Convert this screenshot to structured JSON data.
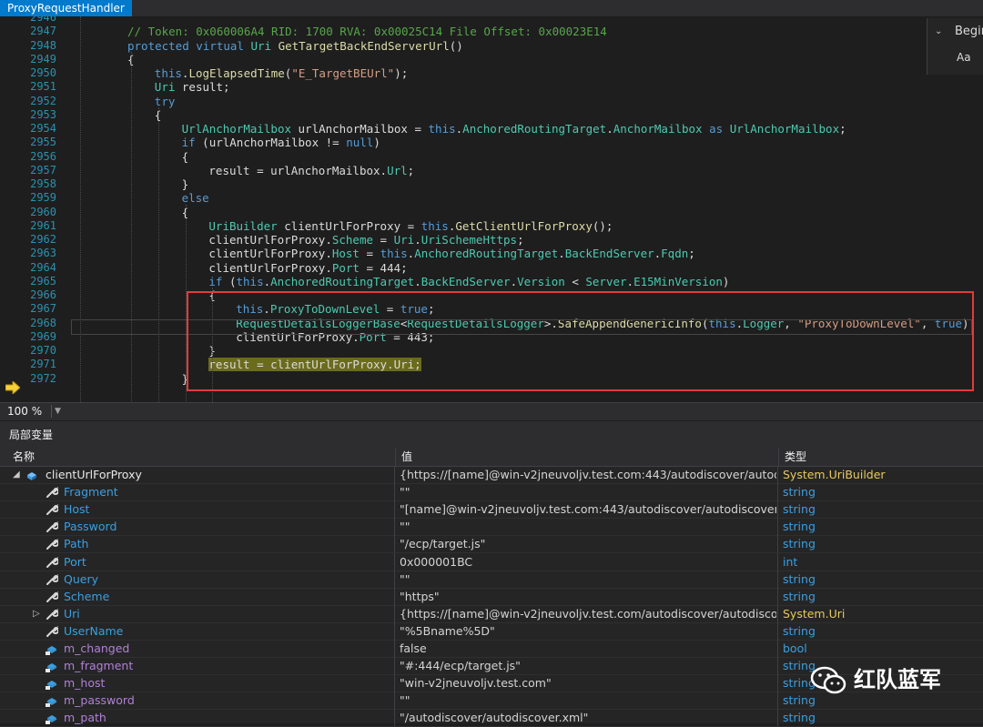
{
  "tab": {
    "title": "ProxyRequestHandler"
  },
  "find": {
    "search_value": "Begin",
    "match_case_label": "Aa"
  },
  "editor": {
    "zoom": "100 %",
    "lines": [
      {
        "n": "2946",
        "indent": 0,
        "tokens": []
      },
      {
        "n": "2947",
        "indent": 1,
        "tokens": [
          {
            "c": "cm",
            "t": "// Token: 0x060006A4 RID: 1700 RVA: 0x00025C14 File Offset: 0x00023E14"
          }
        ]
      },
      {
        "n": "2948",
        "indent": 1,
        "tokens": [
          {
            "c": "kw",
            "t": "protected virtual "
          },
          {
            "c": "ty",
            "t": "Uri "
          },
          {
            "c": "fn",
            "t": "GetTargetBackEndServerUrl"
          },
          {
            "c": "",
            "t": "()"
          }
        ]
      },
      {
        "n": "2949",
        "indent": 1,
        "tokens": [
          {
            "c": "",
            "t": "{"
          }
        ]
      },
      {
        "n": "2950",
        "indent": 2,
        "tokens": [
          {
            "c": "kw",
            "t": "this"
          },
          {
            "c": "",
            "t": "."
          },
          {
            "c": "fn",
            "t": "LogElapsedTime"
          },
          {
            "c": "",
            "t": "("
          },
          {
            "c": "st",
            "t": "\"E_TargetBEUrl\""
          },
          {
            "c": "",
            "t": ");"
          }
        ]
      },
      {
        "n": "2951",
        "indent": 2,
        "tokens": [
          {
            "c": "ty",
            "t": "Uri "
          },
          {
            "c": "",
            "t": "result;"
          }
        ]
      },
      {
        "n": "2952",
        "indent": 2,
        "tokens": [
          {
            "c": "kw",
            "t": "try"
          }
        ]
      },
      {
        "n": "2953",
        "indent": 2,
        "tokens": [
          {
            "c": "",
            "t": "{"
          }
        ]
      },
      {
        "n": "2954",
        "indent": 3,
        "tokens": [
          {
            "c": "ty",
            "t": "UrlAnchorMailbox "
          },
          {
            "c": "",
            "t": "urlAnchorMailbox = "
          },
          {
            "c": "kw",
            "t": "this"
          },
          {
            "c": "",
            "t": "."
          },
          {
            "c": "ty",
            "t": "AnchoredRoutingTarget"
          },
          {
            "c": "",
            "t": "."
          },
          {
            "c": "ty",
            "t": "AnchorMailbox "
          },
          {
            "c": "kw",
            "t": "as "
          },
          {
            "c": "ty",
            "t": "UrlAnchorMailbox"
          },
          {
            "c": "",
            "t": ";"
          }
        ]
      },
      {
        "n": "2955",
        "indent": 3,
        "tokens": [
          {
            "c": "kw",
            "t": "if "
          },
          {
            "c": "",
            "t": "(urlAnchorMailbox != "
          },
          {
            "c": "kw",
            "t": "null"
          },
          {
            "c": "",
            "t": ")"
          }
        ]
      },
      {
        "n": "2956",
        "indent": 3,
        "tokens": [
          {
            "c": "",
            "t": "{"
          }
        ]
      },
      {
        "n": "2957",
        "indent": 4,
        "tokens": [
          {
            "c": "",
            "t": "result = urlAnchorMailbox."
          },
          {
            "c": "ty",
            "t": "Url"
          },
          {
            "c": "",
            "t": ";"
          }
        ]
      },
      {
        "n": "2958",
        "indent": 3,
        "tokens": [
          {
            "c": "",
            "t": "}"
          }
        ]
      },
      {
        "n": "2959",
        "indent": 3,
        "tokens": [
          {
            "c": "kw",
            "t": "else"
          }
        ]
      },
      {
        "n": "2960",
        "indent": 3,
        "tokens": [
          {
            "c": "",
            "t": "{"
          }
        ]
      },
      {
        "n": "2961",
        "indent": 4,
        "tokens": [
          {
            "c": "ty",
            "t": "UriBuilder "
          },
          {
            "c": "",
            "t": "clientUrlForProxy = "
          },
          {
            "c": "kw",
            "t": "this"
          },
          {
            "c": "",
            "t": "."
          },
          {
            "c": "fn",
            "t": "GetClientUrlForProxy"
          },
          {
            "c": "",
            "t": "();"
          }
        ]
      },
      {
        "n": "2962",
        "indent": 4,
        "tokens": [
          {
            "c": "",
            "t": "clientUrlForProxy."
          },
          {
            "c": "ty",
            "t": "Scheme "
          },
          {
            "c": "",
            "t": "= "
          },
          {
            "c": "ty",
            "t": "Uri"
          },
          {
            "c": "",
            "t": "."
          },
          {
            "c": "ty",
            "t": "UriSchemeHttps"
          },
          {
            "c": "",
            "t": ";"
          }
        ]
      },
      {
        "n": "2963",
        "indent": 4,
        "tokens": [
          {
            "c": "",
            "t": "clientUrlForProxy."
          },
          {
            "c": "ty",
            "t": "Host "
          },
          {
            "c": "",
            "t": "= "
          },
          {
            "c": "kw",
            "t": "this"
          },
          {
            "c": "",
            "t": "."
          },
          {
            "c": "ty",
            "t": "AnchoredRoutingTarget"
          },
          {
            "c": "",
            "t": "."
          },
          {
            "c": "ty",
            "t": "BackEndServer"
          },
          {
            "c": "",
            "t": "."
          },
          {
            "c": "ty",
            "t": "Fqdn"
          },
          {
            "c": "",
            "t": ";"
          }
        ]
      },
      {
        "n": "2964",
        "indent": 4,
        "tokens": [
          {
            "c": "",
            "t": "clientUrlForProxy."
          },
          {
            "c": "ty",
            "t": "Port "
          },
          {
            "c": "",
            "t": "= 444;"
          }
        ]
      },
      {
        "n": "2965",
        "indent": 4,
        "tokens": [
          {
            "c": "kw",
            "t": "if "
          },
          {
            "c": "",
            "t": "("
          },
          {
            "c": "kw",
            "t": "this"
          },
          {
            "c": "",
            "t": "."
          },
          {
            "c": "ty",
            "t": "AnchoredRoutingTarget"
          },
          {
            "c": "",
            "t": "."
          },
          {
            "c": "ty",
            "t": "BackEndServer"
          },
          {
            "c": "",
            "t": "."
          },
          {
            "c": "ty",
            "t": "Version "
          },
          {
            "c": "",
            "t": "< "
          },
          {
            "c": "ty",
            "t": "Server"
          },
          {
            "c": "",
            "t": "."
          },
          {
            "c": "ty",
            "t": "E15MinVersion"
          },
          {
            "c": "",
            "t": ")"
          }
        ]
      },
      {
        "n": "2966",
        "indent": 4,
        "tokens": [
          {
            "c": "",
            "t": "{"
          }
        ]
      },
      {
        "n": "2967",
        "indent": 5,
        "tokens": [
          {
            "c": "kw",
            "t": "this"
          },
          {
            "c": "",
            "t": "."
          },
          {
            "c": "ty",
            "t": "ProxyToDownLevel "
          },
          {
            "c": "",
            "t": "= "
          },
          {
            "c": "kw",
            "t": "true"
          },
          {
            "c": "",
            "t": ";"
          }
        ]
      },
      {
        "n": "2968",
        "indent": 5,
        "tokens": [
          {
            "c": "ty",
            "t": "RequestDetailsLoggerBase"
          },
          {
            "c": "",
            "t": "<"
          },
          {
            "c": "ty",
            "t": "RequestDetailsLogger"
          },
          {
            "c": "",
            "t": ">."
          },
          {
            "c": "fn",
            "t": "SafeAppendGenericInfo"
          },
          {
            "c": "",
            "t": "("
          },
          {
            "c": "kw",
            "t": "this"
          },
          {
            "c": "",
            "t": "."
          },
          {
            "c": "ty",
            "t": "Logger"
          },
          {
            "c": "",
            "t": ", "
          },
          {
            "c": "st",
            "t": "\"ProxyToDownLevel\""
          },
          {
            "c": "",
            "t": ", "
          },
          {
            "c": "kw",
            "t": "true"
          },
          {
            "c": "",
            "t": ");"
          }
        ]
      },
      {
        "n": "2969",
        "indent": 5,
        "tokens": [
          {
            "c": "",
            "t": "clientUrlForProxy."
          },
          {
            "c": "ty",
            "t": "Port "
          },
          {
            "c": "",
            "t": "= 443;"
          }
        ]
      },
      {
        "n": "2970",
        "indent": 4,
        "tokens": [
          {
            "c": "",
            "t": "}"
          }
        ]
      },
      {
        "n": "2971",
        "indent": 4,
        "tokens": [
          {
            "c": "exec",
            "t": "result = clientUrlForProxy."
          },
          {
            "c": "exec",
            "t": "Uri"
          },
          {
            "c": "exec",
            "t": ";"
          }
        ]
      },
      {
        "n": "2972",
        "indent": 3,
        "tokens": [
          {
            "c": "",
            "t": "}"
          }
        ]
      }
    ]
  },
  "locals": {
    "title": "局部变量",
    "headers": {
      "name": "名称",
      "value": "值",
      "type": "类型"
    },
    "rows": [
      {
        "kind": "root",
        "expander": "◢",
        "name": "clientUrlForProxy",
        "value": "{https://[name]@win-v2jneuvoljv.test.com:443/autodiscover/autod...",
        "type_ns": "System.",
        "type_name": "UriBuilder"
      },
      {
        "kind": "prop",
        "name": "Fragment",
        "value": "\"\"",
        "type": "string"
      },
      {
        "kind": "prop",
        "name": "Host",
        "value": "\"[name]@win-v2jneuvoljv.test.com:443/autodiscover/autodiscover...",
        "type": "string"
      },
      {
        "kind": "prop",
        "name": "Password",
        "value": "\"\"",
        "type": "string"
      },
      {
        "kind": "prop",
        "name": "Path",
        "value": "\"/ecp/target.js\"",
        "type": "string"
      },
      {
        "kind": "prop",
        "name": "Port",
        "value": "0x000001BC",
        "type": "int"
      },
      {
        "kind": "prop",
        "name": "Query",
        "value": "\"\"",
        "type": "string"
      },
      {
        "kind": "prop",
        "name": "Scheme",
        "value": "\"https\"",
        "type": "string"
      },
      {
        "kind": "prop",
        "expander": "▷",
        "name": "Uri",
        "value": "{https://[name]@win-v2jneuvoljv.test.com/autodiscover/autodisco...",
        "type_ns": "System.",
        "type_name": "Uri"
      },
      {
        "kind": "prop",
        "name": "UserName",
        "value": "\"%5Bname%5D\"",
        "type": "string"
      },
      {
        "kind": "field",
        "name": "m_changed",
        "value": "false",
        "type": "bool"
      },
      {
        "kind": "field",
        "name": "m_fragment",
        "value": "\"#:444/ecp/target.js\"",
        "type": "string"
      },
      {
        "kind": "field",
        "name": "m_host",
        "value": "\"win-v2jneuvoljv.test.com\"",
        "type": "string"
      },
      {
        "kind": "field",
        "name": "m_password",
        "value": "\"\"",
        "type": "string"
      },
      {
        "kind": "field",
        "name": "m_path",
        "value": "\"/autodiscover/autodiscover.xml\"",
        "type": "string"
      }
    ]
  },
  "watermark": {
    "text": "红队蓝军"
  },
  "colors": {
    "accent": "#007acc",
    "highlight_box": "#e23b3b",
    "exec_line": "#6b6b1e"
  }
}
